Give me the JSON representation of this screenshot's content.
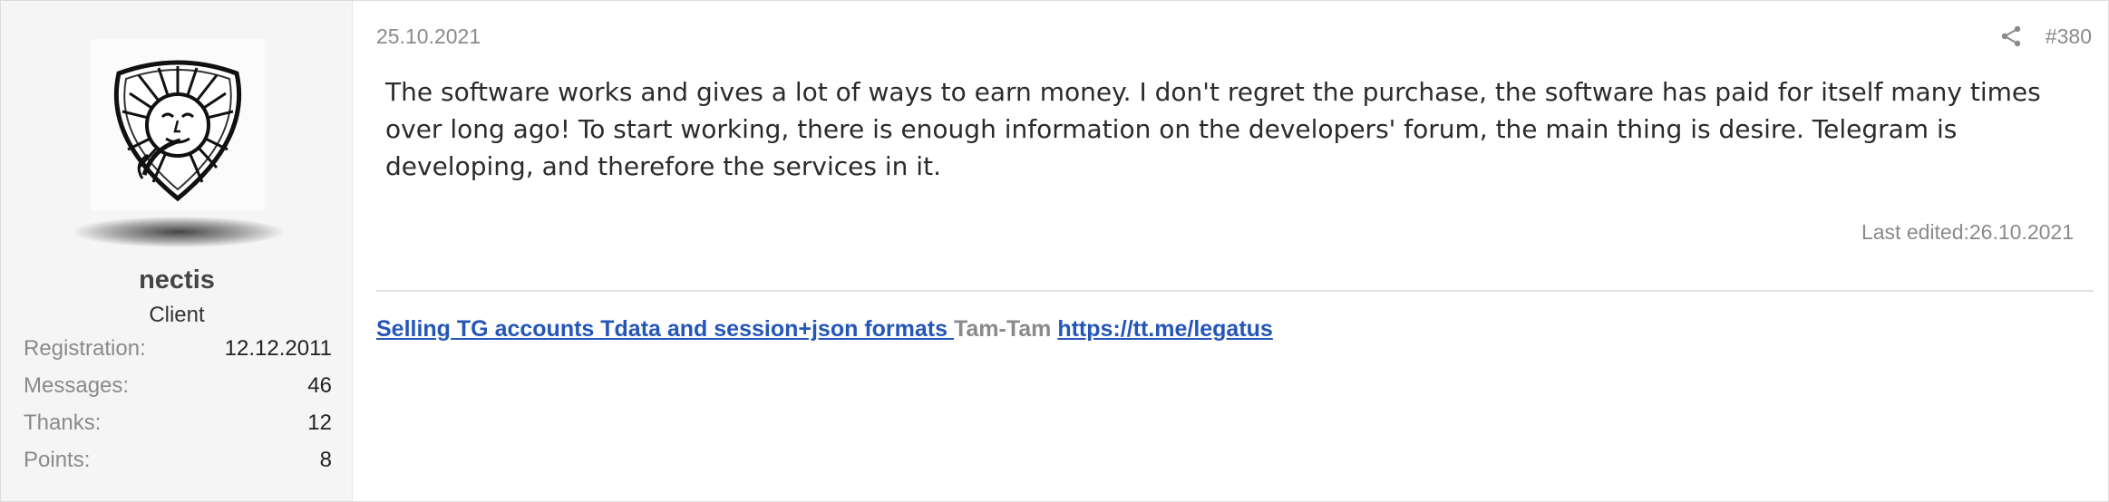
{
  "user": {
    "avatar_icon": "sun-face-shield-icon",
    "name": "nectis",
    "title": "Client",
    "stats": [
      {
        "label": "Registration:",
        "value": "12.12.2011"
      },
      {
        "label": "Messages:",
        "value": "46"
      },
      {
        "label": "Thanks:",
        "value": "12"
      },
      {
        "label": "Points:",
        "value": "8"
      }
    ]
  },
  "post": {
    "date": "25.10.2021",
    "share_icon": "share-icon",
    "number": "#380",
    "body": "The software works and gives a lot of ways to earn money. I don't regret the purchase, the software has paid for itself many times over long ago! To start working, there is enough information on the developers' forum, the main thing is desire. Telegram is developing, and therefore the services in it.",
    "last_edited": "Last edited:26.10.2021"
  },
  "signature": {
    "link1": "Selling TG accounts Tdata and session+json formats ",
    "plain": "Tam-Tam",
    "link2": "https://tt.me/legatus"
  },
  "colors": {
    "link": "#2456b8",
    "muted": "#8a8a8a",
    "sidebar_bg": "#f5f5f5"
  }
}
